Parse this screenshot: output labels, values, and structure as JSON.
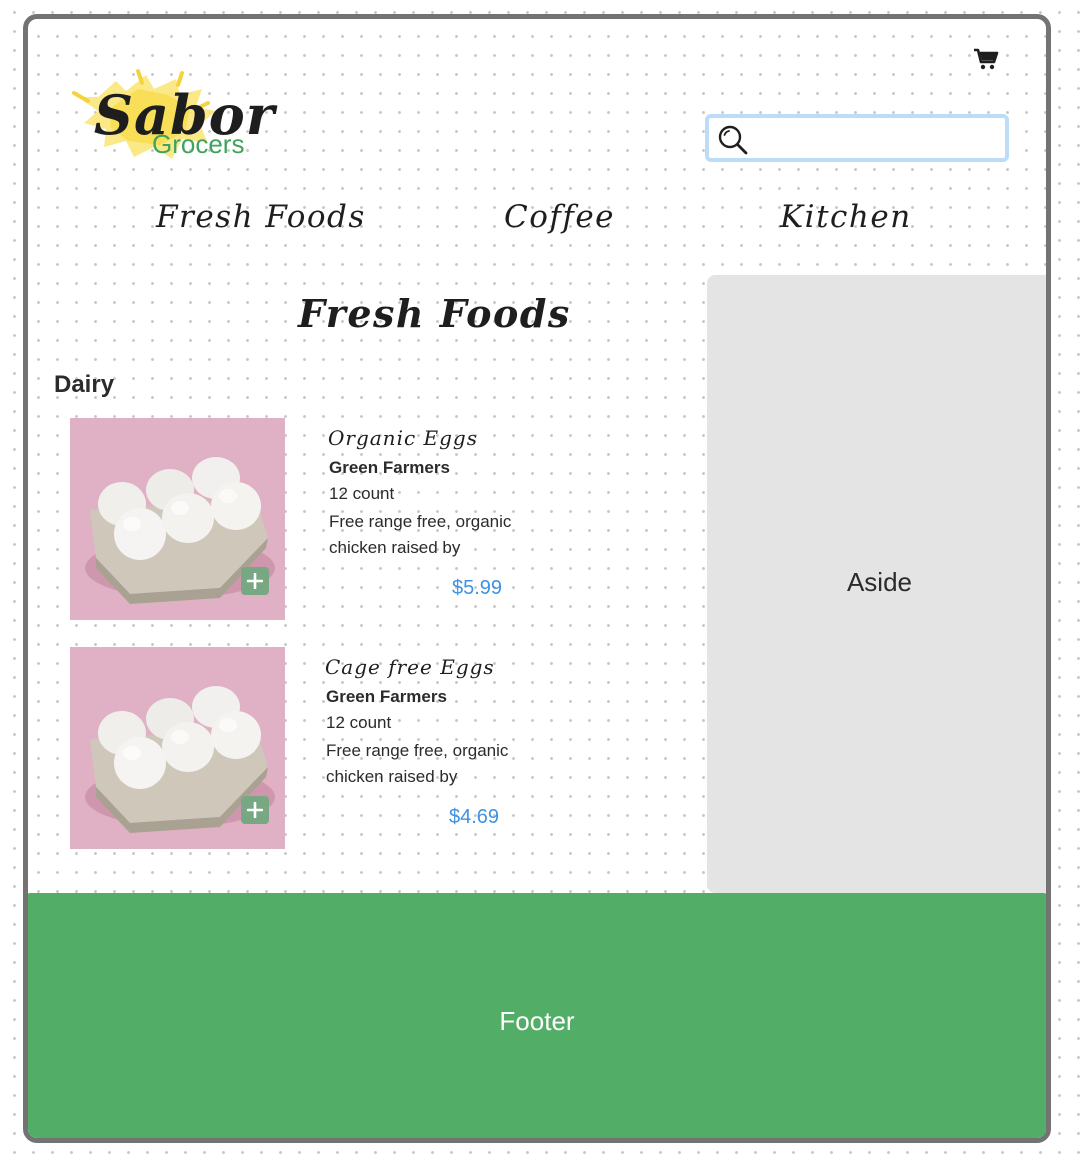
{
  "brand": {
    "name": "Sabor",
    "tagline": "Grocers",
    "accent": "#52ad67"
  },
  "header": {
    "cart_icon": "cart-icon",
    "search": {
      "icon": "search-icon",
      "value": "",
      "placeholder": ""
    }
  },
  "nav": {
    "items": [
      {
        "label": "Fresh Foods"
      },
      {
        "label": "Coffee"
      },
      {
        "label": "Kitchen"
      }
    ]
  },
  "main": {
    "title": "Fresh Foods",
    "section": "Dairy",
    "products": [
      {
        "name": "Organic Eggs",
        "brand": "Green Farmers",
        "count": "12 count",
        "description": "Free range free, organic chicken raised by",
        "price": "$5.99",
        "add_icon": "plus-icon"
      },
      {
        "name": "Cage free Eggs",
        "brand": "Green Farmers",
        "count": "12 count",
        "description": "Free range free, organic chicken raised by",
        "price": "$4.69",
        "add_icon": "plus-icon"
      }
    ]
  },
  "aside": {
    "label": "Aside"
  },
  "footer": {
    "label": "Footer"
  },
  "colors": {
    "price": "#3f92e3",
    "aside_bg": "#e4e4e4",
    "footer_bg": "#52ad67",
    "search_border": "#bcdcf7",
    "product_image_bg": "#e0b1c4"
  }
}
